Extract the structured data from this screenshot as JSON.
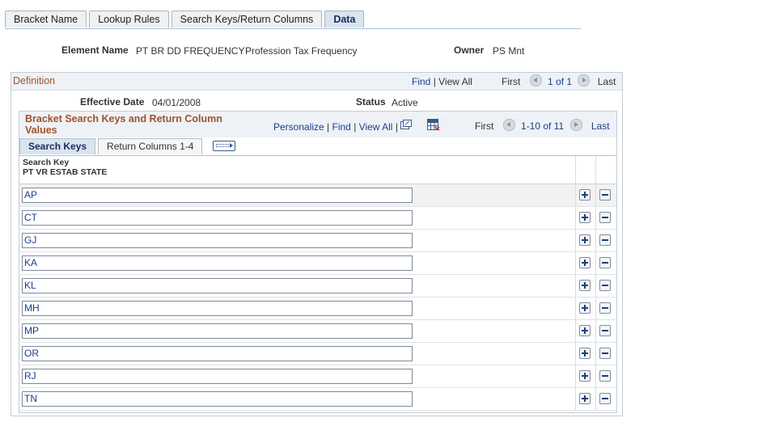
{
  "tabs": [
    {
      "label": "Bracket Name",
      "active": false
    },
    {
      "label": "Lookup Rules",
      "active": false
    },
    {
      "label": "Search Keys/Return Columns",
      "active": false
    },
    {
      "label": "Data",
      "active": true
    }
  ],
  "header": {
    "element_name_label": "Element Name",
    "element_name_value": "PT BR DD FREQUENCY",
    "element_desc": "Profession Tax Frequency",
    "owner_label": "Owner",
    "owner_value": "PS Mnt"
  },
  "definition": {
    "title": "Definition",
    "find": "Find",
    "sep": "|",
    "view_all": "View All",
    "first": "First",
    "range": "1 of 1",
    "last": "Last",
    "effective_date_label": "Effective Date",
    "effective_date_value": "04/01/2008",
    "status_label": "Status",
    "status_value": "Active"
  },
  "grid": {
    "title": "Bracket Search Keys and Return Column Values",
    "personalize": "Personalize",
    "find": "Find",
    "view_all": "View All",
    "sep": "|",
    "first": "First",
    "range": "1-10 of 11",
    "last": "Last",
    "subtabs": [
      {
        "label": "Search Keys",
        "active": true
      },
      {
        "label": "Return Columns 1-4",
        "active": false
      }
    ],
    "col_header_line1": "Search Key",
    "col_header_line2": "PT VR ESTAB STATE",
    "rows": [
      "AP",
      "CT",
      "GJ",
      "KA",
      "KL",
      "MH",
      "MP",
      "OR",
      "RJ",
      "TN"
    ]
  },
  "icons": {
    "zoom": "zoom-grid-icon",
    "download": "download-excel-icon",
    "show_all_columns": "show-all-columns-icon",
    "add_row": "add-row-icon",
    "delete_row": "delete-row-icon"
  }
}
